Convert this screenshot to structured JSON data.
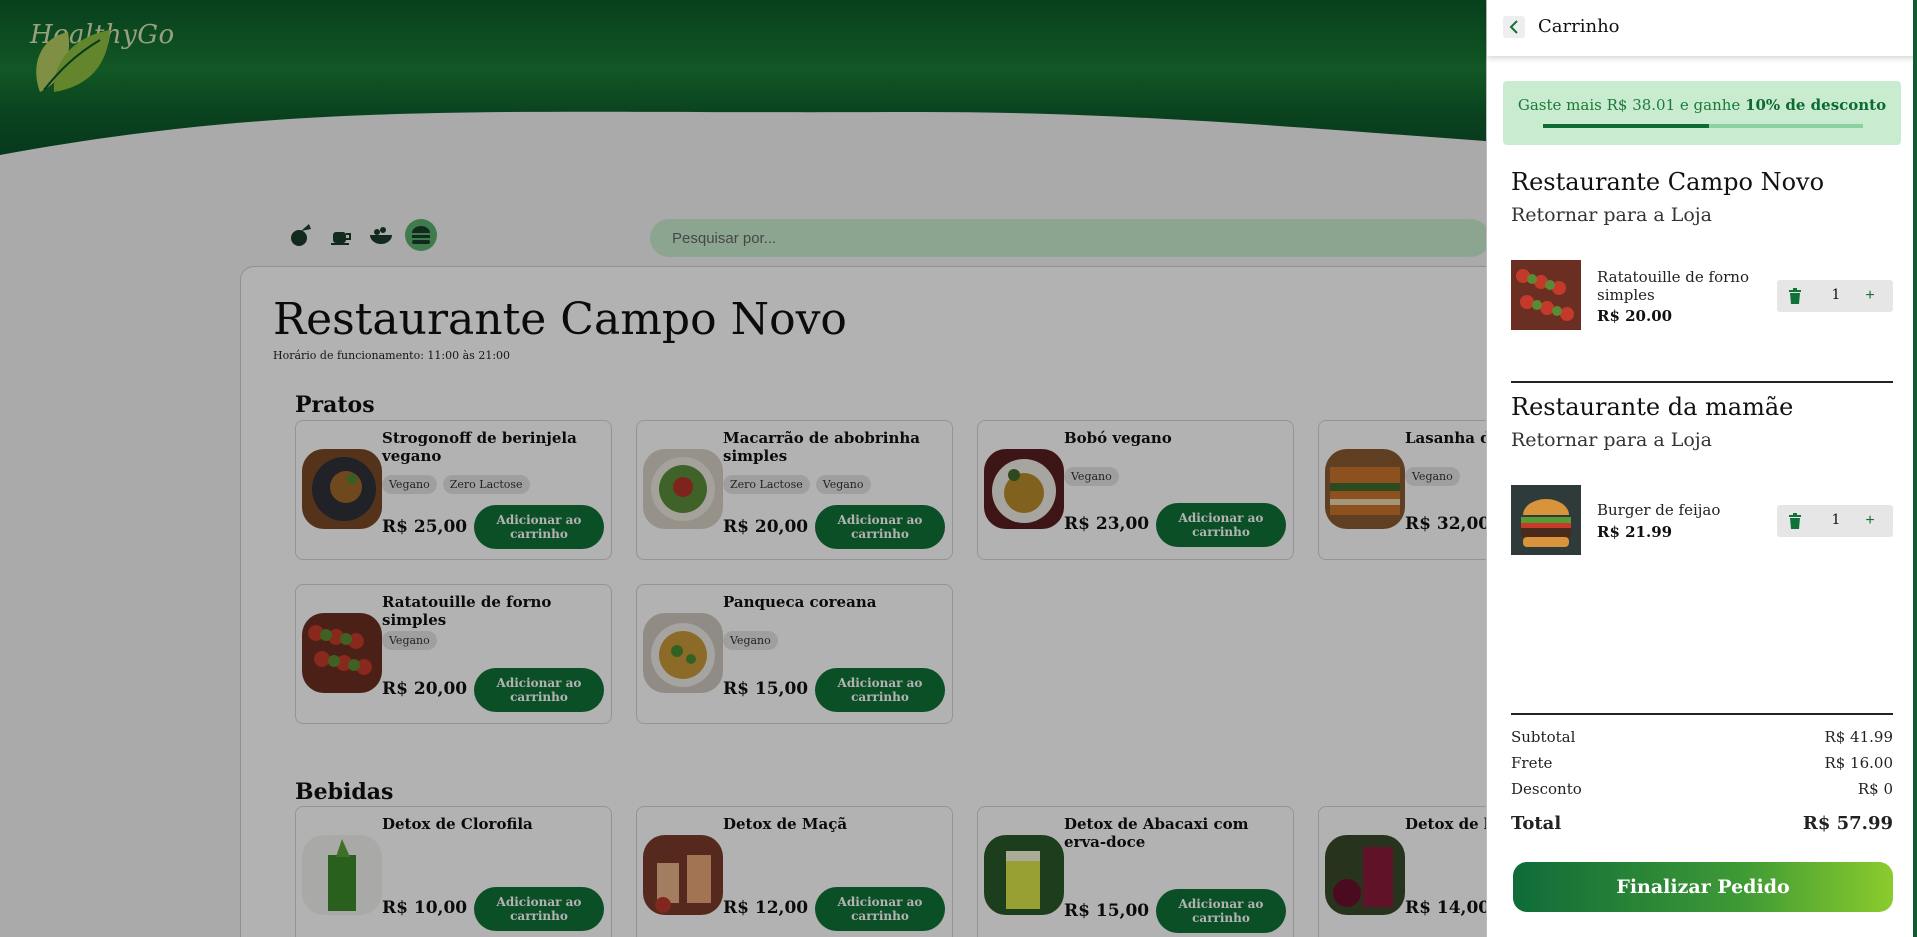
{
  "brand": {
    "name": "HealthyGo"
  },
  "search": {
    "placeholder": "Pesquisar por..."
  },
  "categories": [
    "salad-icon",
    "tea-icon",
    "bowl-icon",
    "burger-icon"
  ],
  "store": {
    "title": "Restaurante Campo Novo",
    "hours": "Horário de funcionamento: 11:00 às 21:00"
  },
  "sections": {
    "pratos": "Pratos",
    "bebidas": "Bebidas"
  },
  "add_label": "Adicionar ao carrinho",
  "pratos": [
    {
      "name": "Strogonoff de berinjela vegano",
      "tags": [
        "Vegano",
        "Zero Lactose"
      ],
      "price": "R$ 25,00"
    },
    {
      "name": "Macarrão de abobrinha simples",
      "tags": [
        "Zero Lactose",
        "Vegano"
      ],
      "price": "R$ 20,00"
    },
    {
      "name": "Bobó vegano",
      "tags": [
        "Vegano"
      ],
      "price": "R$ 23,00"
    },
    {
      "name": "Lasanha de",
      "tags": [
        "Vegano"
      ],
      "price": "R$ 32,00"
    },
    {
      "name": "Ratatouille de forno simples",
      "tags": [
        "Vegano"
      ],
      "price": "R$ 20,00"
    },
    {
      "name": "Panqueca coreana",
      "tags": [
        "Vegano"
      ],
      "price": "R$ 15,00"
    }
  ],
  "bebidas": [
    {
      "name": "Detox de Clorofila",
      "price": "R$ 10,00"
    },
    {
      "name": "Detox de Maçã",
      "price": "R$ 12,00"
    },
    {
      "name": "Detox de Abacaxi com erva-doce",
      "price": "R$ 15,00"
    },
    {
      "name": "Detox de be",
      "price": "R$ 14,00"
    }
  ],
  "cart": {
    "title": "Carrinho",
    "promo": {
      "prefix": "Gaste mais R$ 38.01 e ganhe ",
      "highlight": "10% de desconto",
      "progress": 0.52
    },
    "groups": [
      {
        "store": "Restaurante Campo Novo",
        "return": "Retornar para a Loja",
        "item": {
          "name": "Ratatouille de forno simples",
          "price": "R$ 20.00",
          "qty": "1"
        }
      },
      {
        "store": "Restaurante da mamãe",
        "return": "Retornar para a Loja",
        "item": {
          "name": "Burger de feijao",
          "price": "R$ 21.99",
          "qty": "1"
        }
      }
    ],
    "summary": {
      "subtotal_label": "Subtotal",
      "subtotal": "R$ 41.99",
      "frete_label": "Frete",
      "frete": "R$ 16.00",
      "desconto_label": "Desconto",
      "desconto": "R$ 0",
      "total_label": "Total",
      "total": "R$ 57.99"
    },
    "checkout_label": "Finalizar Pedido"
  },
  "colors": {
    "primary": "#107238",
    "header_dark": "#0a5a2c",
    "promo_bg": "#c9ecd0"
  }
}
